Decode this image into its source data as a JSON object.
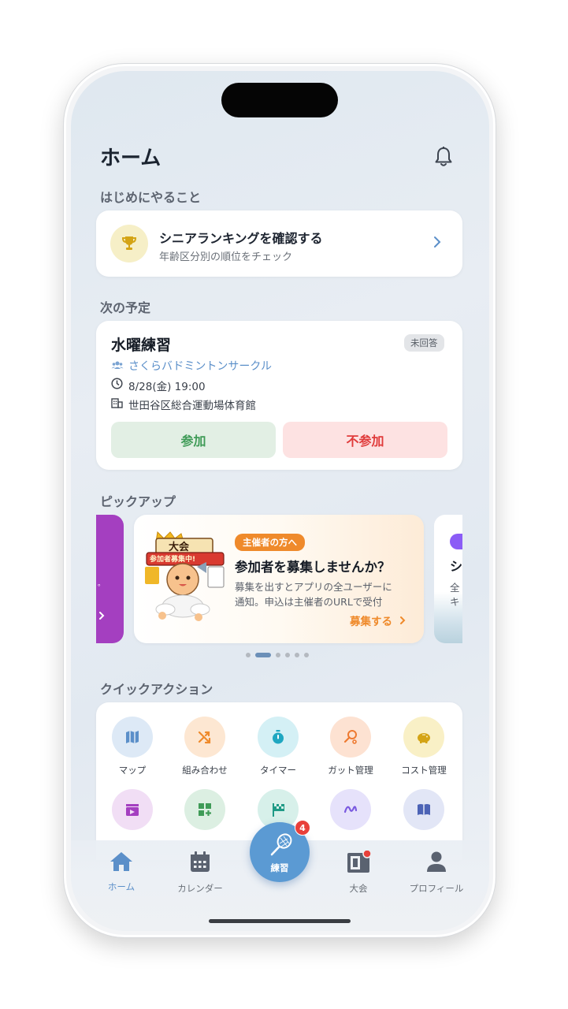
{
  "header": {
    "title": "ホーム"
  },
  "first_steps": {
    "section_label": "はじめにやること",
    "card": {
      "title": "シニアランキングを確認する",
      "subtitle": "年齢区分別の順位をチェック"
    }
  },
  "next_event": {
    "section_label": "次の予定",
    "title": "水曜練習",
    "status_badge": "未回答",
    "circle": "さくらバドミントンサークル",
    "datetime": "8/28(金) 19:00",
    "venue": "世田谷区総合運動場体育館",
    "join_label": "参加",
    "decline_label": "不参加"
  },
  "pickup": {
    "section_label": "ピックアップ",
    "card": {
      "tag": "主催者の方へ",
      "title": "参加者を募集しませんか？",
      "body_line1": "募集を出すとアプリの全ユーザーに",
      "body_line2": "通知。申込は主催者のURLで受付",
      "cta": "募集する",
      "illustration_banner_top": "大会",
      "illustration_banner_bottom": "参加者募集中!"
    },
    "dots_count": 6,
    "active_dot": 1
  },
  "quick_actions": {
    "section_label": "クイックアクション",
    "row1": [
      {
        "label": "マップ",
        "icon": "map-icon"
      },
      {
        "label": "組み合わせ",
        "icon": "shuffle-icon"
      },
      {
        "label": "タイマー",
        "icon": "timer-icon"
      },
      {
        "label": "ガット管理",
        "icon": "racket-string-icon"
      },
      {
        "label": "コスト管理",
        "icon": "piggy-bank-icon"
      }
    ],
    "row2_icons": [
      "video-clapper-icon",
      "dashboard-add-icon",
      "flag-checkered-icon",
      "pattern-icon",
      "book-icon"
    ]
  },
  "tab_bar": {
    "home": "ホーム",
    "calendar": "カレンダー",
    "practice": "練習",
    "practice_badge": "4",
    "tournament": "大会",
    "profile": "プロフィール"
  },
  "colors": {
    "accent": "#5b8fc9",
    "join_bg": "#e2efe4",
    "join_text": "#3f9b57",
    "decline_bg": "#fde2e2",
    "decline_text": "#e03b3b",
    "orange": "#ef8a2b",
    "purple": "#a43fc0"
  }
}
